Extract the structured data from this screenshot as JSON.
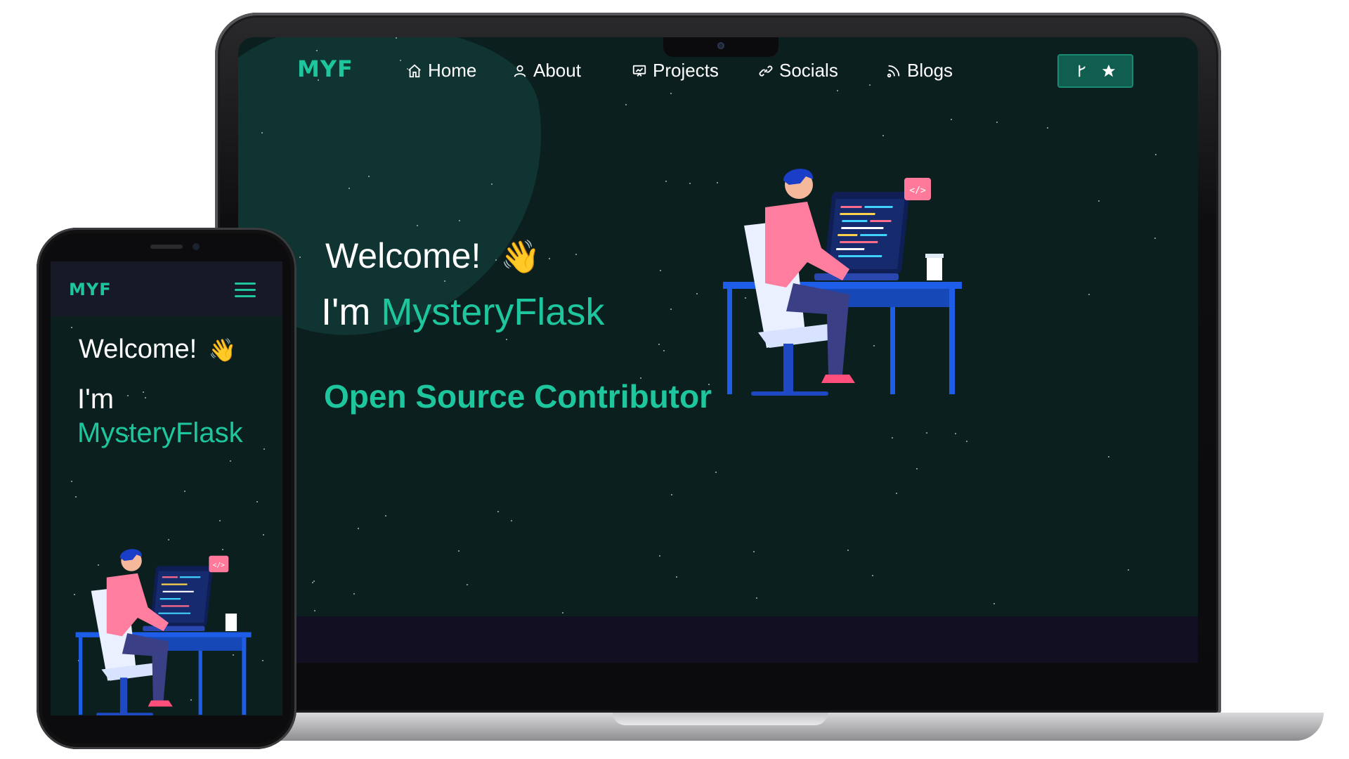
{
  "laptop": {
    "logo": "MYF",
    "nav": [
      {
        "label": "Home",
        "icon": "home-icon"
      },
      {
        "label": "About",
        "icon": "user-icon"
      },
      {
        "label": "Projects",
        "icon": "presentation-icon"
      },
      {
        "label": "Socials",
        "icon": "link-icon"
      },
      {
        "label": "Blogs",
        "icon": "rss-icon"
      }
    ],
    "github_button": {
      "icons": [
        "fork-icon",
        "star-icon"
      ]
    },
    "hero": {
      "welcome": "Welcome!",
      "im_prefix": "I'm",
      "name": "MysteryFlask",
      "role": "Open Source Contributor"
    }
  },
  "phone": {
    "logo": "MYF",
    "hero": {
      "welcome": "Welcome!",
      "im_prefix": "I'm",
      "name": "MysteryFlask"
    }
  },
  "colors": {
    "accent": "#1ec69e",
    "background": "#0c1f1f",
    "footer": "#130f22"
  }
}
